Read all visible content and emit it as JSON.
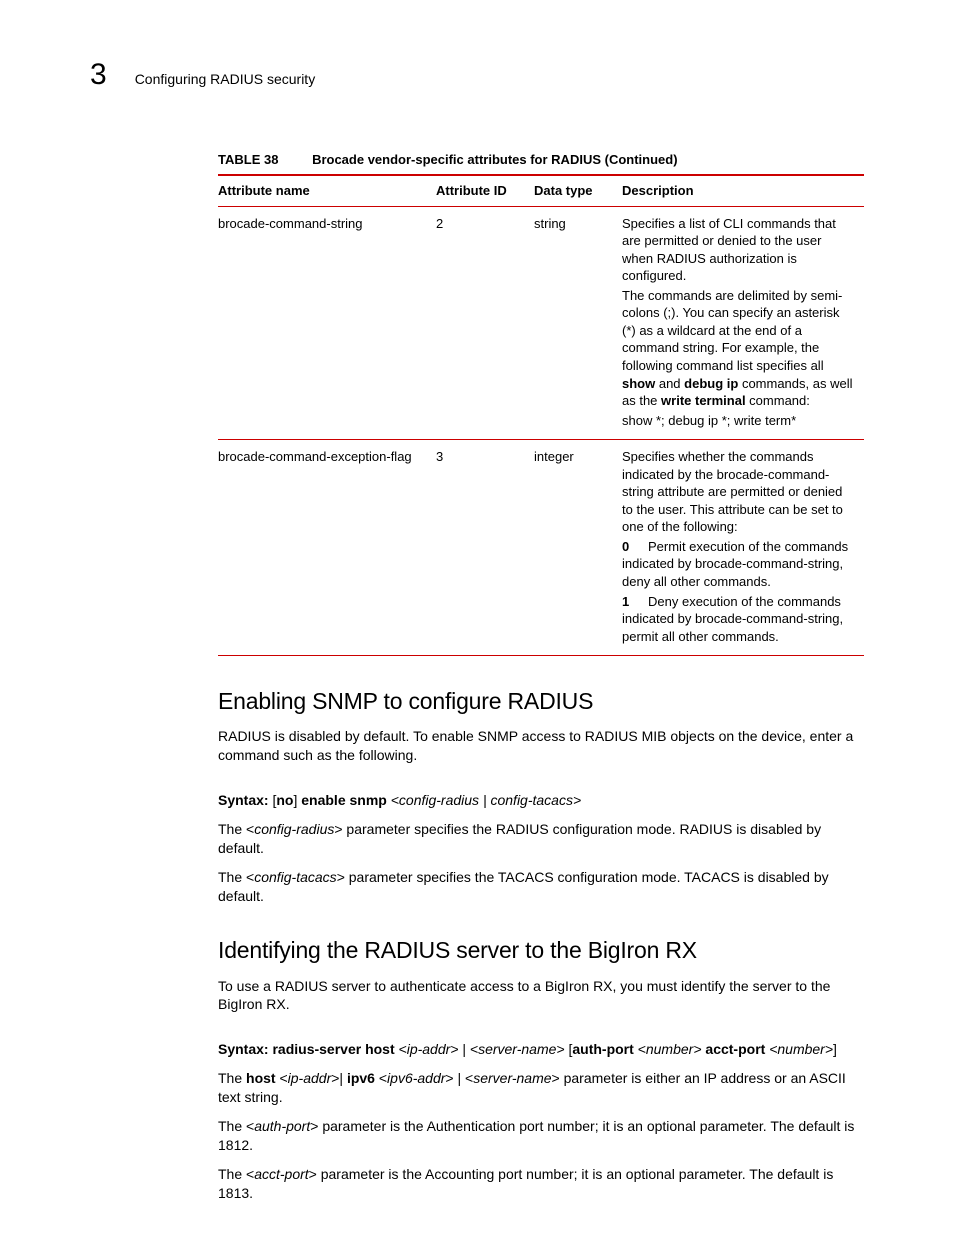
{
  "header": {
    "chapter": "3",
    "title": "Configuring RADIUS security"
  },
  "table": {
    "label": "TABLE 38",
    "caption": "Brocade vendor-specific attributes for RADIUS (Continued)",
    "columns": {
      "name": "Attribute name",
      "id": "Attribute ID",
      "type": "Data type",
      "desc": "Description"
    },
    "rows": [
      {
        "name": "brocade-command-string",
        "id": "2",
        "type": "string",
        "desc": {
          "p1": "Specifies a list of CLI commands that are permitted or denied to the user when RADIUS authorization is configured.",
          "p2_pre": "The commands are delimited by semi-colons (;).  You can specify an asterisk (*) as a wildcard at the end of a command string. For example, the following command list specifies all ",
          "p2_b1": "show",
          "p2_mid1": " and ",
          "p2_b2": "debug ip",
          "p2_mid2": " commands, as well as the ",
          "p2_b3": "write terminal",
          "p2_post": " command:",
          "p3": "show *; debug ip *; write term*"
        }
      },
      {
        "name": "brocade-command-exception-flag",
        "id": "3",
        "type": "integer",
        "desc": {
          "p1": "Specifies whether the commands indicated by the brocade-command-string attribute are permitted or denied to the user. This attribute can be set to one of the following:",
          "opt0_num": "0",
          "opt0_txt": "Permit execution of the commands",
          "opt0_cont": "indicated by brocade-command-string, deny all other commands.",
          "opt1_num": "1",
          "opt1_txt": "Deny execution of the commands",
          "opt1_cont": "indicated by brocade-command-string, permit all other commands."
        }
      }
    ]
  },
  "section1": {
    "heading": "Enabling SNMP to configure RADIUS",
    "intro": "RADIUS is disabled by default. To enable SNMP access to RADIUS MIB objects on the device, enter a command such as the following.",
    "syntax": {
      "label": "Syntax:",
      "no_open": " [",
      "no": "no",
      "no_close": "] ",
      "cmd": "enable snmp",
      "args": " <config-radius | config-tacacs>"
    },
    "p1a": "The <",
    "p1i": "config-radius",
    "p1b": "> parameter specifies the RADIUS configuration mode. RADIUS is disabled by default.",
    "p2a": "The <",
    "p2i": "config-tacacs",
    "p2b": "> parameter specifies the TACACS configuration mode. TACACS is disabled by default."
  },
  "section2": {
    "heading": "Identifying the RADIUS server to the BigIron RX",
    "intro": "To use a RADIUS server to authenticate access to a BigIron RX, you must identify the server to the BigIron RX.",
    "syntax": {
      "label": "Syntax:",
      "cmd": " radius-server host",
      "a1": " <ip-addr>",
      "sep1": " | ",
      "a2": "<server-name>",
      "sep2": " [",
      "b1": "auth-port",
      "a3": " <number>",
      "sp": " ",
      "b2": "acct-port",
      "a4": " <number>",
      "close": "]"
    },
    "p1a": "The ",
    "p1b1": "host",
    "p1m1": " <",
    "p1i1": "ip-addr",
    "p1m2": ">| ",
    "p1b2": "ipv6",
    "p1m3": " <",
    "p1i2": "ipv6-addr",
    "p1m4": "> | <",
    "p1i3": "server-name",
    "p1m5": "> parameter is either an IP address or an ASCII text string.",
    "p2a": "The <",
    "p2i": "auth-port",
    "p2b": "> parameter is the Authentication port number; it is an optional parameter.  The default is 1812.",
    "p3a": "The <",
    "p3i": "acct-port",
    "p3b": "> parameter is the Accounting port number; it is an optional parameter.  The default is 1813."
  }
}
